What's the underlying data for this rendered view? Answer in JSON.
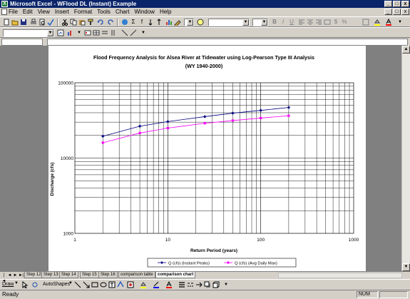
{
  "window": {
    "title": "Microsoft Excel - WFlood DL (Instant) Example",
    "min_label": "_",
    "max_label": "□",
    "close_label": "x",
    "app_icon_glyph": "X"
  },
  "menubar": {
    "items": [
      "File",
      "Edit",
      "View",
      "Insert",
      "Format",
      "Tools",
      "Chart",
      "Window",
      "Help"
    ]
  },
  "toolbar": {
    "zoom_arrow": "▼",
    "font_arrow": "▼",
    "size_arrow": "▼",
    "bold_label": "B",
    "italic_label": "I",
    "underline_label": "U"
  },
  "sheet_tabs": {
    "tabs": [
      "Step 12",
      "Step 13",
      "Step 14",
      "Step 15",
      "Step 16",
      "comparison table",
      "comparison chart"
    ],
    "active_index": 6,
    "nav": [
      "|◄",
      "◄",
      "►",
      "►|"
    ]
  },
  "drawing_toolbar": {
    "draw_label": "Draw",
    "autoshapes_label": "AutoShapes"
  },
  "status": {
    "ready": "Ready",
    "num": "NUM"
  },
  "chart_data": {
    "type": "line",
    "title": "Flood Frequency Analysis for Alsea River at Tidewater using Log-Pearson Type III Analysis",
    "subtitle": "(WY 1940-2000)",
    "xlabel": "Return Period (years)",
    "ylabel": "Discharge (cfs)",
    "x_scale": "log",
    "y_scale": "log",
    "xlim": [
      1,
      1000
    ],
    "ylim": [
      1000,
      100000
    ],
    "x_tick_labels": [
      "1",
      "10",
      "100",
      "1000"
    ],
    "y_tick_labels": [
      "1000",
      "10000",
      "100000"
    ],
    "grid": true,
    "legend_position": "bottom",
    "series": [
      {
        "name": "Q (cfs) (Instant Peaks)",
        "color": "#000080",
        "marker": "diamond",
        "x": [
          2,
          5,
          10,
          25,
          50,
          100,
          200
        ],
        "y": [
          19500,
          26500,
          30500,
          35500,
          39500,
          43000,
          47000
        ]
      },
      {
        "name": "Q (cfs) (Avg Daily Max)",
        "color": "#ff00ff",
        "marker": "square",
        "x": [
          2,
          5,
          10,
          25,
          50,
          100,
          200
        ],
        "y": [
          16000,
          21500,
          25000,
          29000,
          31500,
          34000,
          36500
        ]
      }
    ]
  }
}
